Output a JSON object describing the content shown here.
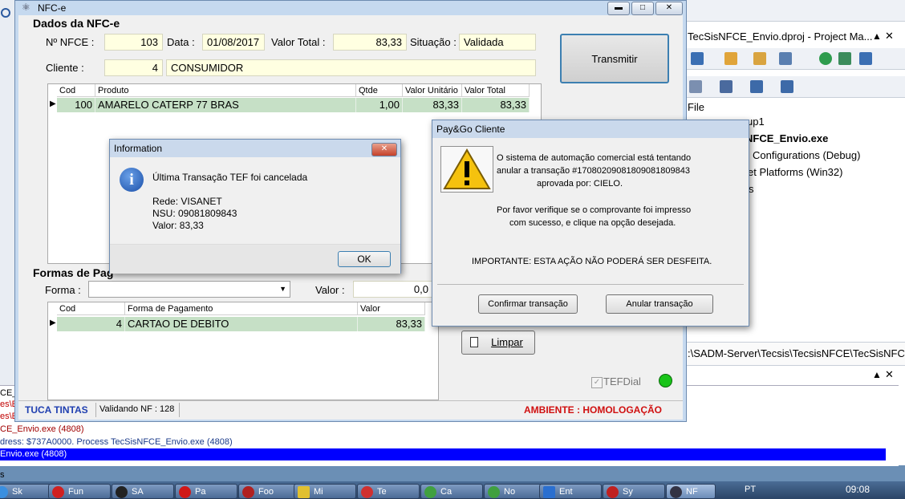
{
  "ide": {
    "project_tab": "TecSisNFCE_Envio.dproj - Project Ma...",
    "tree": [
      "File",
      "up1",
      "NFCE_Envio.exe",
      "Configurations (Debug)",
      "et Platforms (Win32)",
      "s"
    ],
    "path": ":\\SADM-Server\\Tecsis\\TecsisNFCE\\TecSisNFC",
    "logs": [
      "CE_",
      "es\\E",
      "es\\E",
      "CE_Envio.exe (4808)",
      "dress: $737A0000. Process TecSisNFCE_Envio.exe (4808)",
      "Envio.exe (4808)"
    ],
    "bottom_left": "s"
  },
  "taskbar": {
    "items": [
      "Sk",
      "Fun",
      "SA",
      "Pa",
      "Foo",
      "Mi",
      "Te",
      "Ca",
      "No",
      "Ent",
      "Sy",
      "NF"
    ],
    "lang": "PT",
    "clock": "09:08"
  },
  "nfce": {
    "title": "NFC-e",
    "section_dados": "Dados da NFC-e",
    "num_label": "Nº NFCE :",
    "num_value": "103",
    "data_label": "Data :",
    "data_value": "01/08/2017",
    "total_label": "Valor Total :",
    "total_value": "83,33",
    "situacao_label": "Situação :",
    "situacao_value": "Validada",
    "cliente_label": "Cliente :",
    "cliente_code": "4",
    "cliente_name": "CONSUMIDOR",
    "transmitir_label": "Transmitir",
    "products": {
      "headers": [
        "Cod",
        "Produto",
        "Qtde",
        "Valor Unitário",
        "Valor Total"
      ],
      "rows": [
        [
          "100",
          "AMARELO CATERP 77 BRAS",
          "1,00",
          "83,33",
          "83,33"
        ]
      ]
    },
    "section_formas": "Formas de Pag",
    "forma_label": "Forma :",
    "valor_label": "Valor :",
    "valor_value": "0,0",
    "payments": {
      "headers": [
        "Cod",
        "Forma de Pagamento",
        "Valor"
      ],
      "rows": [
        [
          "4",
          "CARTAO DE DEBITO",
          "83,33"
        ]
      ]
    },
    "limpar_label": "Limpar",
    "tefdial_label": "TEFDial",
    "status_company": "TUCA TINTAS",
    "status_msg": "Validando NF : 128",
    "status_env": "AMBIENTE : HOMOLOGAÇÃO"
  },
  "info_dialog": {
    "title": "Information",
    "message": "Última Transação TEF foi cancelada",
    "rede": "Rede: VISANET",
    "nsu": "NSU: 09081809843",
    "valor": "Valor: 83,33",
    "ok_label": "OK"
  },
  "paygo_dialog": {
    "title": "Pay&Go Cliente",
    "line1": "O sistema de automação comercial está tentando",
    "line2": "anular a transação #17080209081809081809843",
    "line3": "aprovada por: CIELO.",
    "line4": "Por favor verifique se o comprovante foi impresso",
    "line5": "com sucesso, e clique na opção desejada.",
    "important": "IMPORTANTE: ESTA AÇÃO NÃO PODERÁ SER DESFEITA.",
    "confirm_label": "Confirmar transação",
    "cancel_label": "Anular transação"
  },
  "colors": {
    "status_blue": "#1f3fb0",
    "status_red": "#d01010",
    "log_blue": "#0000ff",
    "green_led": "#19c419"
  }
}
